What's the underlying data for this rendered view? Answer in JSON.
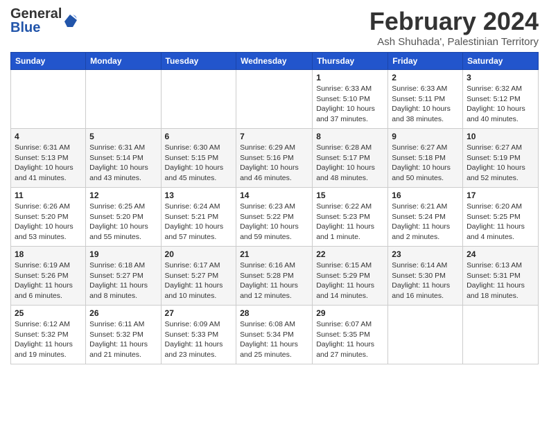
{
  "logo": {
    "line1": "General",
    "line2": "Blue"
  },
  "header": {
    "month": "February 2024",
    "location": "Ash Shuhada', Palestinian Territory"
  },
  "weekdays": [
    "Sunday",
    "Monday",
    "Tuesday",
    "Wednesday",
    "Thursday",
    "Friday",
    "Saturday"
  ],
  "weeks": [
    [
      {
        "day": "",
        "info": ""
      },
      {
        "day": "",
        "info": ""
      },
      {
        "day": "",
        "info": ""
      },
      {
        "day": "",
        "info": ""
      },
      {
        "day": "1",
        "info": "Sunrise: 6:33 AM\nSunset: 5:10 PM\nDaylight: 10 hours and 37 minutes."
      },
      {
        "day": "2",
        "info": "Sunrise: 6:33 AM\nSunset: 5:11 PM\nDaylight: 10 hours and 38 minutes."
      },
      {
        "day": "3",
        "info": "Sunrise: 6:32 AM\nSunset: 5:12 PM\nDaylight: 10 hours and 40 minutes."
      }
    ],
    [
      {
        "day": "4",
        "info": "Sunrise: 6:31 AM\nSunset: 5:13 PM\nDaylight: 10 hours and 41 minutes."
      },
      {
        "day": "5",
        "info": "Sunrise: 6:31 AM\nSunset: 5:14 PM\nDaylight: 10 hours and 43 minutes."
      },
      {
        "day": "6",
        "info": "Sunrise: 6:30 AM\nSunset: 5:15 PM\nDaylight: 10 hours and 45 minutes."
      },
      {
        "day": "7",
        "info": "Sunrise: 6:29 AM\nSunset: 5:16 PM\nDaylight: 10 hours and 46 minutes."
      },
      {
        "day": "8",
        "info": "Sunrise: 6:28 AM\nSunset: 5:17 PM\nDaylight: 10 hours and 48 minutes."
      },
      {
        "day": "9",
        "info": "Sunrise: 6:27 AM\nSunset: 5:18 PM\nDaylight: 10 hours and 50 minutes."
      },
      {
        "day": "10",
        "info": "Sunrise: 6:27 AM\nSunset: 5:19 PM\nDaylight: 10 hours and 52 minutes."
      }
    ],
    [
      {
        "day": "11",
        "info": "Sunrise: 6:26 AM\nSunset: 5:20 PM\nDaylight: 10 hours and 53 minutes."
      },
      {
        "day": "12",
        "info": "Sunrise: 6:25 AM\nSunset: 5:20 PM\nDaylight: 10 hours and 55 minutes."
      },
      {
        "day": "13",
        "info": "Sunrise: 6:24 AM\nSunset: 5:21 PM\nDaylight: 10 hours and 57 minutes."
      },
      {
        "day": "14",
        "info": "Sunrise: 6:23 AM\nSunset: 5:22 PM\nDaylight: 10 hours and 59 minutes."
      },
      {
        "day": "15",
        "info": "Sunrise: 6:22 AM\nSunset: 5:23 PM\nDaylight: 11 hours and 1 minute."
      },
      {
        "day": "16",
        "info": "Sunrise: 6:21 AM\nSunset: 5:24 PM\nDaylight: 11 hours and 2 minutes."
      },
      {
        "day": "17",
        "info": "Sunrise: 6:20 AM\nSunset: 5:25 PM\nDaylight: 11 hours and 4 minutes."
      }
    ],
    [
      {
        "day": "18",
        "info": "Sunrise: 6:19 AM\nSunset: 5:26 PM\nDaylight: 11 hours and 6 minutes."
      },
      {
        "day": "19",
        "info": "Sunrise: 6:18 AM\nSunset: 5:27 PM\nDaylight: 11 hours and 8 minutes."
      },
      {
        "day": "20",
        "info": "Sunrise: 6:17 AM\nSunset: 5:27 PM\nDaylight: 11 hours and 10 minutes."
      },
      {
        "day": "21",
        "info": "Sunrise: 6:16 AM\nSunset: 5:28 PM\nDaylight: 11 hours and 12 minutes."
      },
      {
        "day": "22",
        "info": "Sunrise: 6:15 AM\nSunset: 5:29 PM\nDaylight: 11 hours and 14 minutes."
      },
      {
        "day": "23",
        "info": "Sunrise: 6:14 AM\nSunset: 5:30 PM\nDaylight: 11 hours and 16 minutes."
      },
      {
        "day": "24",
        "info": "Sunrise: 6:13 AM\nSunset: 5:31 PM\nDaylight: 11 hours and 18 minutes."
      }
    ],
    [
      {
        "day": "25",
        "info": "Sunrise: 6:12 AM\nSunset: 5:32 PM\nDaylight: 11 hours and 19 minutes."
      },
      {
        "day": "26",
        "info": "Sunrise: 6:11 AM\nSunset: 5:32 PM\nDaylight: 11 hours and 21 minutes."
      },
      {
        "day": "27",
        "info": "Sunrise: 6:09 AM\nSunset: 5:33 PM\nDaylight: 11 hours and 23 minutes."
      },
      {
        "day": "28",
        "info": "Sunrise: 6:08 AM\nSunset: 5:34 PM\nDaylight: 11 hours and 25 minutes."
      },
      {
        "day": "29",
        "info": "Sunrise: 6:07 AM\nSunset: 5:35 PM\nDaylight: 11 hours and 27 minutes."
      },
      {
        "day": "",
        "info": ""
      },
      {
        "day": "",
        "info": ""
      }
    ]
  ]
}
